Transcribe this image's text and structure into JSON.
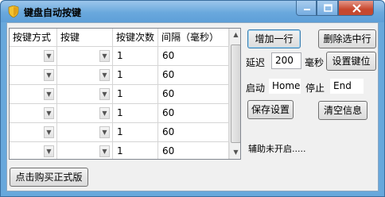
{
  "window": {
    "title": "键盘自动按键",
    "controls": {
      "minimize": "−",
      "maximize": "□",
      "close": "×"
    }
  },
  "grid": {
    "columns": [
      "按键方式",
      "按键",
      "按键次数",
      "间隔（毫秒）"
    ],
    "rows": [
      {
        "mode": "",
        "key": "",
        "count": "1",
        "interval": "60"
      },
      {
        "mode": "",
        "key": "",
        "count": "1",
        "interval": "60"
      },
      {
        "mode": "",
        "key": "",
        "count": "1",
        "interval": "60"
      },
      {
        "mode": "",
        "key": "",
        "count": "1",
        "interval": "60"
      },
      {
        "mode": "",
        "key": "",
        "count": "1",
        "interval": "60"
      },
      {
        "mode": "",
        "key": "",
        "count": "1",
        "interval": "60"
      }
    ]
  },
  "buttons": {
    "add_row": "增加一行",
    "delete_selected": "删除选中行",
    "set_key": "设置键位",
    "save_settings": "保存设置",
    "clear_info": "清空信息",
    "buy": "点击购买正式版"
  },
  "delay": {
    "label": "延迟",
    "value": "200",
    "unit": "毫秒"
  },
  "hotkeys": {
    "start_label": "启动",
    "start_value": "Home",
    "stop_label": "停止",
    "stop_value": "End"
  },
  "status": "辅助未开启.....",
  "colors": {
    "titlebar": "#6aa8dd",
    "close_button": "#c8472e",
    "client": "#f0f0f0"
  }
}
